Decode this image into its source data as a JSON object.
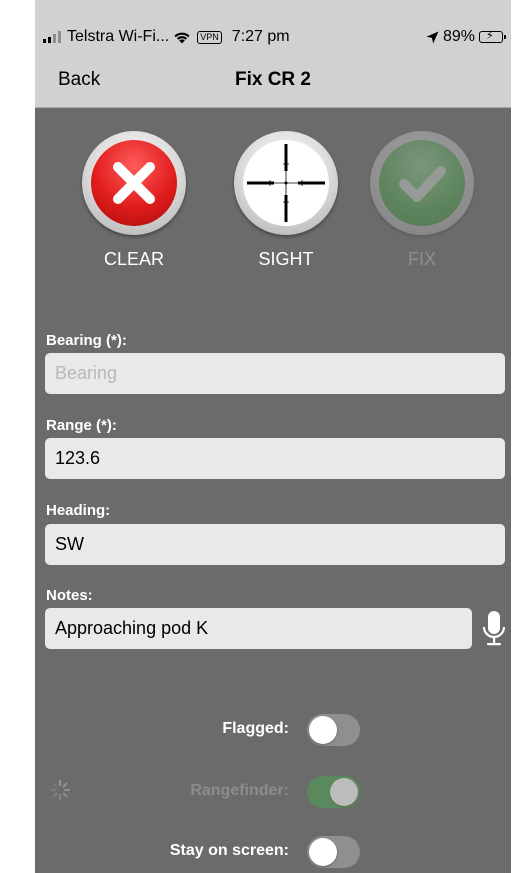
{
  "status_bar": {
    "carrier": "Telstra Wi-Fi...",
    "vpn": "VPN",
    "time": "7:27 pm",
    "battery_percent": "89%",
    "battery_level": 0.89,
    "location_icon": "location-arrow-icon",
    "wifi_icon": "wifi-icon",
    "battery_color": "#35c759"
  },
  "nav": {
    "back_label": "Back",
    "title": "Fix CR 2"
  },
  "actions": {
    "clear_label": "CLEAR",
    "sight_label": "SIGHT",
    "fix_label": "FIX",
    "fix_enabled": false,
    "clear_icon": "x-icon",
    "sight_icon": "crosshair-icon",
    "fix_icon": "checkmark-icon",
    "clear_color": "#e11d1d",
    "fix_color": "#44b544"
  },
  "form": {
    "bearing": {
      "label": "Bearing (*):",
      "value": "",
      "placeholder": "Bearing"
    },
    "range": {
      "label": "Range (*):",
      "value": "123.6"
    },
    "heading": {
      "label": "Heading:",
      "value": "SW"
    },
    "notes": {
      "label": "Notes:",
      "value": "Approaching pod K",
      "mic_icon": "microphone-icon"
    }
  },
  "toggles": {
    "flagged": {
      "label": "Flagged:",
      "on": false,
      "enabled": true
    },
    "rangefinder": {
      "label": "Rangefinder:",
      "on": true,
      "enabled": false
    },
    "stay_on_screen": {
      "label": "Stay on screen:",
      "on": false,
      "enabled": true
    }
  },
  "colors": {
    "background": "#6b6b6b",
    "nav_background": "#d1d1d1",
    "switch_on": "#4fa355"
  }
}
